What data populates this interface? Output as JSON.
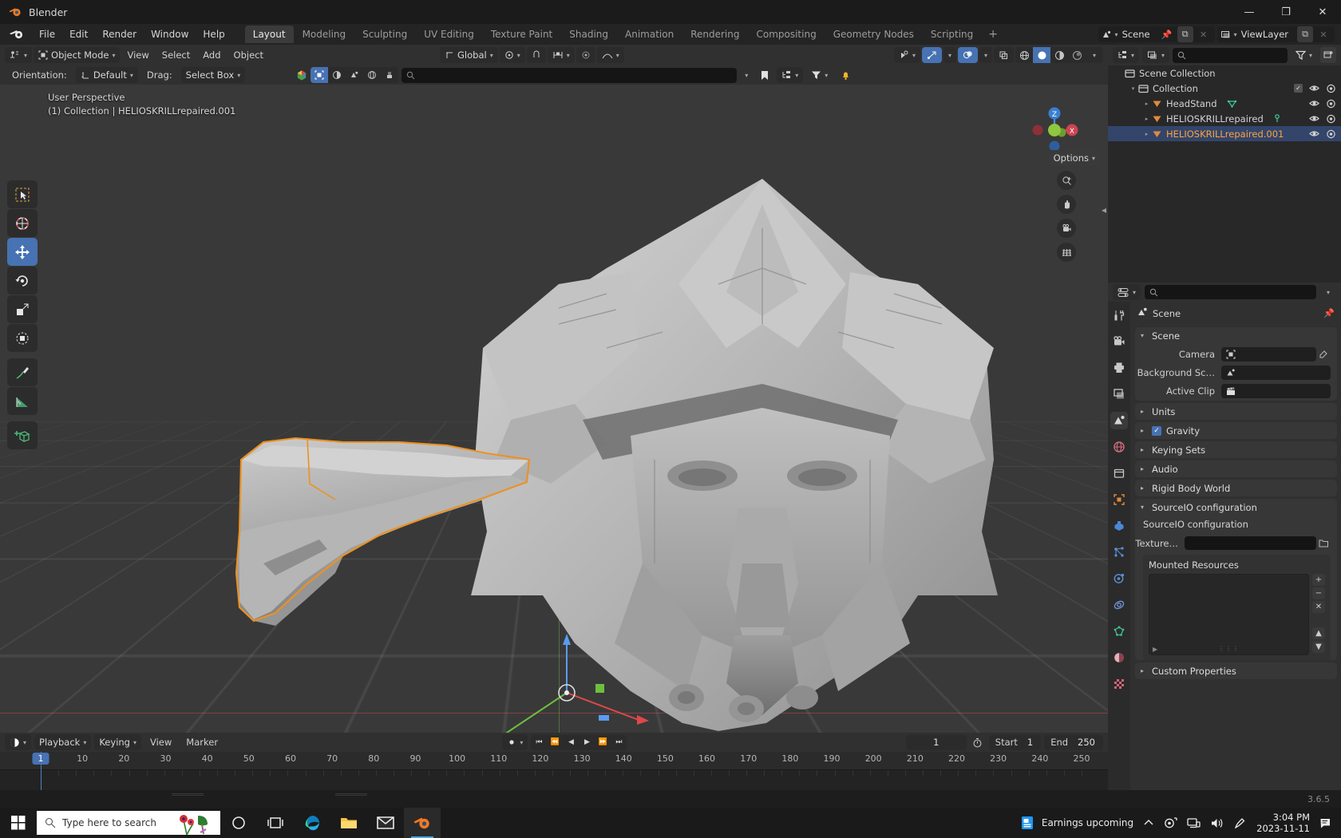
{
  "window": {
    "title": "Blender",
    "controls": {
      "minimize": "—",
      "maximize": "❐",
      "close": "✕"
    }
  },
  "topbar": {
    "menus": [
      "File",
      "Edit",
      "Render",
      "Window",
      "Help"
    ],
    "workspaces": [
      {
        "label": "Layout",
        "active": true
      },
      {
        "label": "Modeling",
        "active": false
      },
      {
        "label": "Sculpting",
        "active": false
      },
      {
        "label": "UV Editing",
        "active": false
      },
      {
        "label": "Texture Paint",
        "active": false
      },
      {
        "label": "Shading",
        "active": false
      },
      {
        "label": "Animation",
        "active": false
      },
      {
        "label": "Rendering",
        "active": false
      },
      {
        "label": "Compositing",
        "active": false
      },
      {
        "label": "Geometry Nodes",
        "active": false
      },
      {
        "label": "Scripting",
        "active": false
      }
    ],
    "add_workspace": "+",
    "scene_name": "Scene",
    "viewlayer_name": "ViewLayer"
  },
  "viewport_header": {
    "mode": "Object Mode",
    "menus": [
      "View",
      "Select",
      "Add",
      "Object"
    ],
    "transform_orientation": "Global",
    "orientation_label": "Orientation:",
    "orientation_value": "Default",
    "drag_label": "Drag:",
    "drag_value": "Select Box",
    "options_label": "Options"
  },
  "viewport": {
    "info_line1": "User Perspective",
    "info_line2": "(1) Collection | HELIOSKRILLrepaired.001",
    "gizmo_axes": [
      "Z",
      "X"
    ],
    "tools": [
      "tweak-select-box-tool",
      "cursor-tool",
      "move-tool",
      "rotate-tool",
      "scale-tool",
      "transform-tool",
      "annotate-tool",
      "measure-tool",
      "add-cube-tool"
    ],
    "active_tool": "move-tool",
    "nav_buttons": [
      "zoom-icon",
      "hand-icon",
      "camera-icon",
      "grid-icon"
    ],
    "shading_mode": "solid"
  },
  "outliner": {
    "rows": [
      {
        "name": "Scene Collection",
        "indent": 0,
        "icon": "collection-icon",
        "disclosure": "",
        "selected": false,
        "checkbox": false,
        "eye": false,
        "camera": false
      },
      {
        "name": "Collection",
        "indent": 1,
        "icon": "collection-icon",
        "disclosure": "▾",
        "selected": false,
        "checkbox": true,
        "eye": true,
        "camera": true
      },
      {
        "name": "HeadStand",
        "indent": 2,
        "icon": "mesh-object-icon",
        "disclosure": "▸",
        "selected": false,
        "checkbox": false,
        "eye": true,
        "camera": true,
        "data_icon": "mesh-data-icon"
      },
      {
        "name": "HELIOSKRILLrepaired",
        "indent": 2,
        "icon": "mesh-object-icon",
        "disclosure": "▸",
        "selected": false,
        "checkbox": false,
        "eye": true,
        "camera": true,
        "data_icon": "modifier-icon"
      },
      {
        "name": "HELIOSKRILLrepaired.001",
        "indent": 2,
        "icon": "mesh-object-icon",
        "disclosure": "▸",
        "selected": true,
        "checkbox": false,
        "eye": true,
        "camera": true
      }
    ]
  },
  "properties": {
    "breadcrumb": "Scene",
    "panels": [
      {
        "label": "Scene",
        "open": true,
        "checkbox": null
      },
      {
        "label": "Units",
        "open": false,
        "checkbox": null
      },
      {
        "label": "Gravity",
        "open": false,
        "checkbox": true
      },
      {
        "label": "Keying Sets",
        "open": false,
        "checkbox": null
      },
      {
        "label": "Audio",
        "open": false,
        "checkbox": null
      },
      {
        "label": "Rigid Body World",
        "open": false,
        "checkbox": null
      },
      {
        "label": "SourceIO configuration",
        "open": true,
        "checkbox": null
      },
      {
        "label": "Custom Properties",
        "open": false,
        "checkbox": null
      }
    ],
    "scene_fields": [
      {
        "label": "Camera",
        "value": "",
        "icon": "camera-data-icon",
        "eyedropper": true
      },
      {
        "label": "Background Sc…",
        "value": "",
        "icon": "scene-data-icon",
        "eyedropper": false
      },
      {
        "label": "Active Clip",
        "value": "",
        "icon": "clip-data-icon",
        "eyedropper": false
      }
    ],
    "sourceio": {
      "heading": "SourceIO configuration",
      "texture_label": "Texture…",
      "texture_value": "",
      "mounted_title": "Mounted Resources",
      "list_items": [],
      "buttons": [
        "+",
        "−",
        "✕",
        "▲",
        "▼"
      ]
    },
    "tabs": [
      "tool-tab",
      "render-tab",
      "output-tab",
      "view-layer-tab",
      "scene-tab",
      "world-tab",
      "collection-tab",
      "object-tab",
      "modifier-tab",
      "particles-tab",
      "physics-tab",
      "constraints-tab",
      "data-tab",
      "material-tab",
      "texture-tab"
    ],
    "active_tab": "scene-tab"
  },
  "timeline": {
    "editor_menus": [
      "Playback",
      "Keying",
      "View",
      "Marker"
    ],
    "current_frame": "1",
    "start_label": "Start",
    "start_value": "1",
    "end_label": "End",
    "end_value": "250",
    "ticks": [
      "1",
      "10",
      "20",
      "30",
      "40",
      "50",
      "60",
      "70",
      "80",
      "90",
      "100",
      "110",
      "120",
      "130",
      "140",
      "150",
      "160",
      "170",
      "180",
      "190",
      "200",
      "210",
      "220",
      "230",
      "240",
      "250"
    ],
    "playback_buttons": [
      "jump-start-icon",
      "prev-keyframe-icon",
      "play-reverse-icon",
      "play-icon",
      "next-keyframe-icon",
      "jump-end-icon"
    ]
  },
  "statusbar": {
    "version": "3.6.5"
  },
  "taskbar": {
    "search_placeholder": "Type here to search",
    "icons": [
      "cortana-icon",
      "task-view-icon",
      "edge-icon",
      "file-explorer-icon",
      "mail-icon",
      "blender-icon"
    ],
    "active_icon": "blender-icon",
    "tray_text": "Earnings upcoming",
    "time": "3:04 PM",
    "date": "2023-11-11"
  },
  "colors": {
    "accent_blue": "#4772b3",
    "select_orange": "#ffa33c",
    "panel_bg": "#303030",
    "viewport_bg": "#393939"
  }
}
